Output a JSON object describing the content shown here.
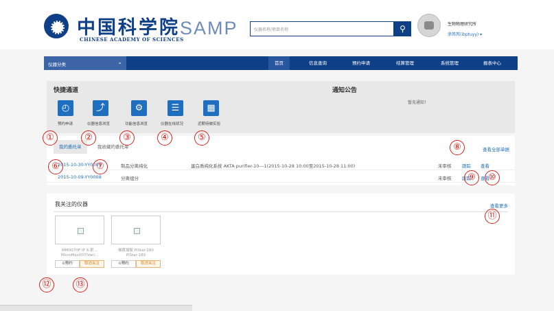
{
  "header": {
    "logo_cn": "中国科学院",
    "logo_en": "CHINESE ACADEMY OF SCIENCES",
    "samp": "SAMP",
    "search_placeholder": "仪器名称/项目名称",
    "search_icon": "search-icon",
    "org": "生物物理研究所",
    "user": "涂芮芮(ibptuyy) ▾"
  },
  "nav": {
    "category": "仪器分类",
    "items": [
      "首页",
      "信息查询",
      "预约申请",
      "结算管理",
      "系统管理",
      "报表中心"
    ],
    "active_index": 0
  },
  "shortcuts": {
    "title": "快捷通道",
    "items": [
      {
        "label": "预约申请",
        "icon": "clock-icon"
      },
      {
        "label": "仪器信息浏览",
        "icon": "share-icon"
      },
      {
        "label": "功能信息浏览",
        "icon": "gear-icon"
      },
      {
        "label": "仪器在线状况",
        "icon": "list-icon"
      },
      {
        "label": "近期待做实验",
        "icon": "calendar-icon"
      }
    ]
  },
  "notice": {
    "title": "通知公告",
    "empty": "暂无通知！"
  },
  "orders": {
    "tabs": [
      "我的委托单",
      "我收藏的委托单"
    ],
    "view_all": "查看全部单据",
    "rows": [
      {
        "id": "2015-10-30-YY0009",
        "project": "制品分离纯化",
        "detail": "蛋白质纯化系统 AKTA purifier-10---1(2015-10-28 10:00至2015-10-28 11:00)",
        "status": "未审核",
        "action1": "跟踪",
        "action2": "查看"
      },
      {
        "id": "2015-10-09-YY0008",
        "project": "分离组分",
        "detail": "",
        "status": "未审核",
        "action1": "跟踪",
        "action2": "查看"
      }
    ]
  },
  "followed": {
    "title": "我关注的仪器",
    "see_more": "查看更多",
    "cards": [
      {
        "line1": "MM007HF IP X-射...",
        "line2": "MicroMax007/Vari...",
        "book": "⊙预约",
        "unfollow": "取消关注"
      },
      {
        "line1": "梯度凝胶 PiStar-180",
        "line2": "PiStar-180",
        "book": "⊙预约",
        "unfollow": "取消关注"
      }
    ]
  },
  "annotations": [
    "①",
    "②",
    "③",
    "④",
    "⑤",
    "⑥",
    "⑦",
    "⑧",
    "⑨",
    "⑩",
    "⑪",
    "⑫",
    "⑬"
  ],
  "colors": {
    "brand_blue": "#0f3f86",
    "accent_blue": "#1f6fc1",
    "annotation_red": "#d9211c"
  }
}
